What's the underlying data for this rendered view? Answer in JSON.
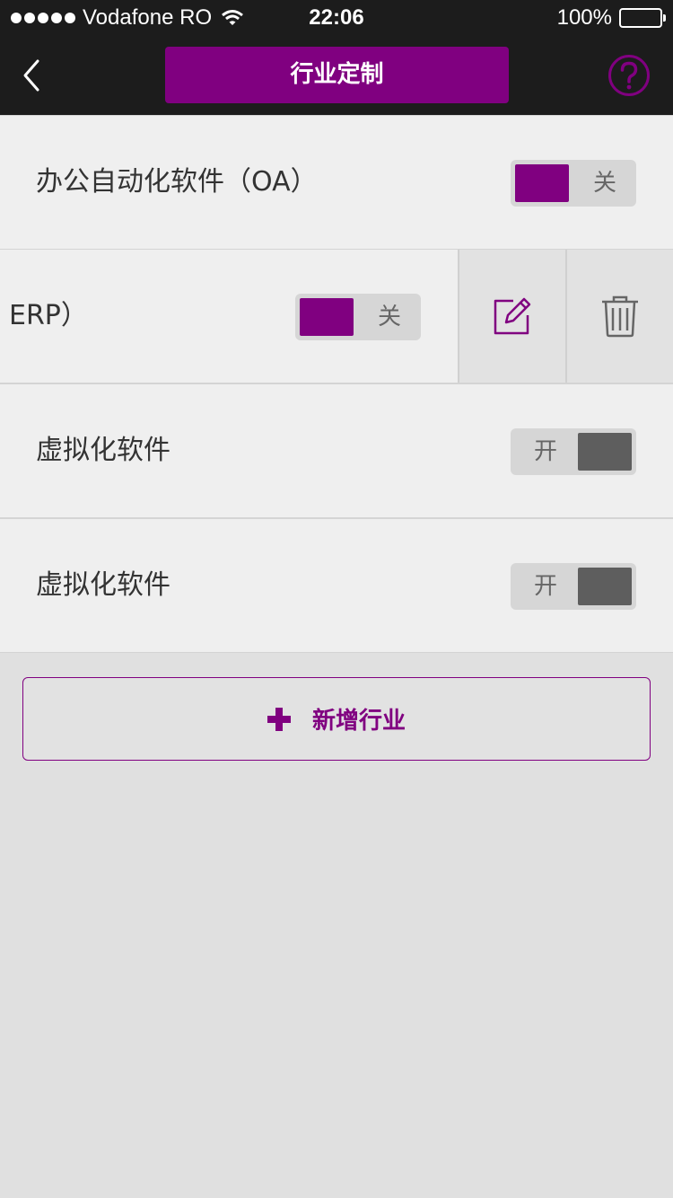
{
  "status_bar": {
    "carrier": "Vodafone RO",
    "time": "22:06",
    "battery": "100%"
  },
  "nav": {
    "title": "行业定制",
    "back_icon": "chevron-left-icon",
    "help_icon": "question-circle-icon"
  },
  "items": [
    {
      "label": "办公自动化软件（OA）",
      "toggle_text": "关",
      "state": "off"
    },
    {
      "label": "ERP）",
      "toggle_text": "关",
      "state": "off"
    },
    {
      "label": "虚拟化软件",
      "toggle_text": "开",
      "state": "on"
    },
    {
      "label": "虚拟化软件",
      "toggle_text": "开",
      "state": "on"
    }
  ],
  "swipe_actions": {
    "edit_icon": "edit-icon",
    "delete_icon": "trash-icon"
  },
  "add_button": {
    "label": "新增行业",
    "icon": "plus-icon"
  },
  "colors": {
    "accent": "#800080",
    "nav_bg": "#1c1c1c",
    "page_bg": "#e0e0e0",
    "row_bg": "#efefef"
  }
}
